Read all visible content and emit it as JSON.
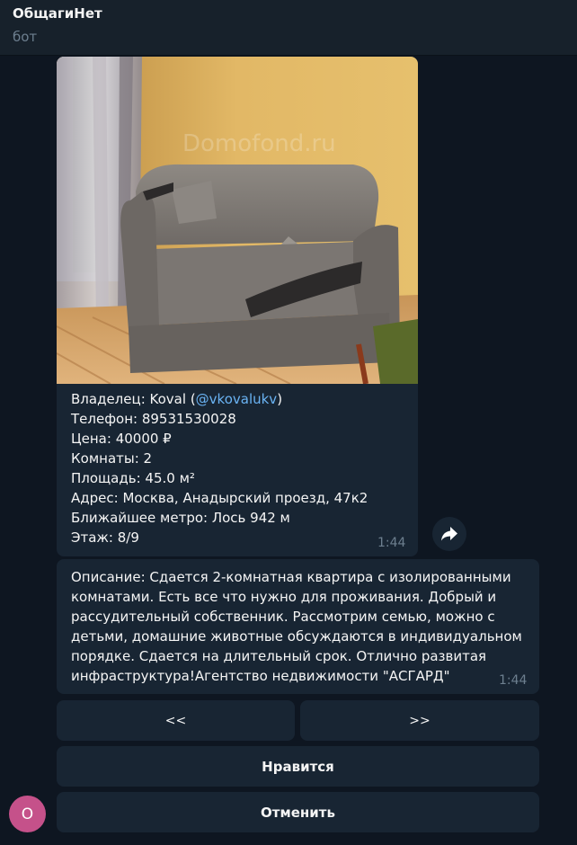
{
  "header": {
    "title": "ОбщагиНет",
    "subtitle": "бот"
  },
  "listing": {
    "watermark": "Domofond.ru",
    "owner_label": "Владелец: ",
    "owner_name": "Koval",
    "owner_open": " (",
    "owner_handle": "@vkovalukv",
    "owner_close": ")",
    "phone": "Телефон: 89531530028",
    "price": "Цена: 40000 ₽",
    "rooms": "Комнаты: 2",
    "area": "Площадь: 45.0 м²",
    "address": "Адрес: Москва, Анадырский проезд, 47к2",
    "metro": "Ближайшее метро: Лось 942 м",
    "floor": "Этаж: 8/9",
    "time": "1:44"
  },
  "description": {
    "lines": [
      "Описание: Сдается  2-комнатная квартира с изолированными",
      "комнатами.  Есть все что нужно для проживания. Добрый и",
      "рассудительный собственник. Рассмотрим семью, можно с",
      "детьми, домашние животные обсуждаются в индивидуальном",
      "порядке. Сдается на длительный срок. Отлично развитая",
      "инфраструктура!Агентство недвижимости \"АСГАРД\""
    ],
    "time": "1:44"
  },
  "keyboard": {
    "prev": "<<",
    "next": ">>",
    "like": "Нравится",
    "cancel": "Отменить"
  },
  "avatar": {
    "letter": "О",
    "color": "#c5518a"
  },
  "icons": {
    "share": "share-arrow-icon"
  }
}
